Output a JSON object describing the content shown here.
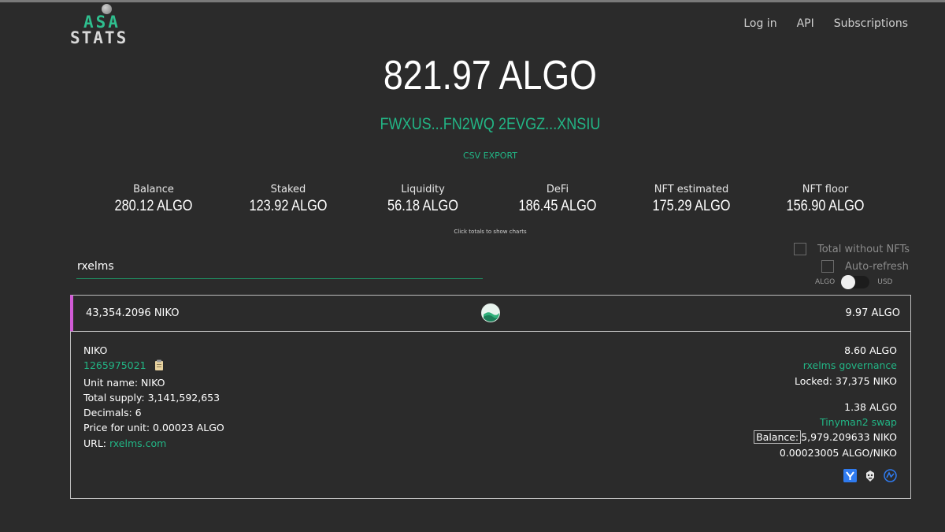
{
  "logo": {
    "line1": "ASA",
    "line2": "STATS"
  },
  "nav": {
    "login": "Log in",
    "api": "API",
    "subscriptions": "Subscriptions"
  },
  "wallet": {
    "total": "821.97 ALGO",
    "address": "FWXUS...FN2WQ 2EVGZ...XNSIU",
    "csv_export": "CSV EXPORT"
  },
  "stats": [
    {
      "label": "Balance",
      "value": "280.12 ALGO"
    },
    {
      "label": "Staked",
      "value": "123.92 ALGO"
    },
    {
      "label": "Liquidity",
      "value": "56.18 ALGO"
    },
    {
      "label": "DeFi",
      "value": "186.45 ALGO"
    },
    {
      "label": "NFT estimated",
      "value": "175.29 ALGO"
    },
    {
      "label": "NFT floor",
      "value": "156.90 ALGO"
    }
  ],
  "hint": "Click totals to show charts",
  "search": {
    "value": "rxelms"
  },
  "options": {
    "total_without_nfts": "Total without NFTs",
    "auto_refresh": "Auto-refresh",
    "currency_left": "ALGO",
    "currency_right": "USD"
  },
  "asset": {
    "amount": "43,354.2096  NIKO",
    "value": "9.97 ALGO",
    "name": "NIKO",
    "id": "1265975021",
    "unit_name": "Unit name: NIKO",
    "total_supply": "Total supply: 3,141,592,653",
    "decimals": "Decimals: 6",
    "price": "Price for unit: 0.00023 ALGO",
    "url_label": "URL: ",
    "url": "rxelms.com",
    "governance_value": "8.60 ALGO",
    "governance_label": "rxelms governance",
    "locked": "Locked: 37,375 NIKO",
    "swap_value": "1.38 ALGO",
    "swap_label": "Tinyman2 swap",
    "balance_label": "Balance:",
    "balance_value": "5,979.209633 NIKO",
    "swap_rate": "0.00023005 ALGO/NIKO"
  },
  "colors": {
    "accent": "#22b585",
    "row_marker": "#d15bd6",
    "background": "#2b2b2b"
  }
}
